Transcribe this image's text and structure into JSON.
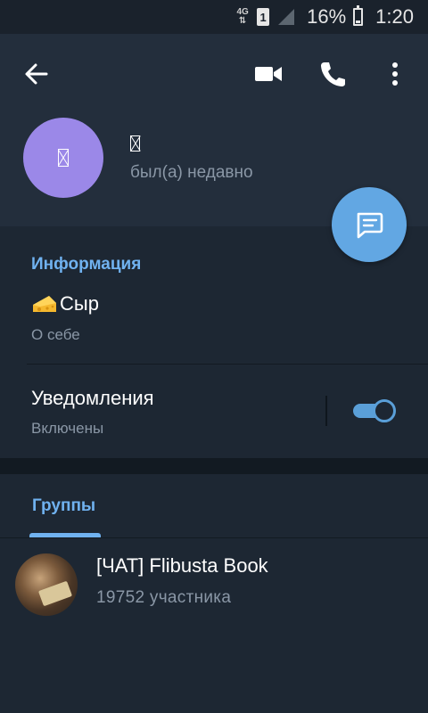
{
  "status_bar": {
    "network": "4G",
    "sim": "1",
    "battery": "16%",
    "battery_level": 0.16,
    "time": "1:20"
  },
  "header": {
    "icons": [
      "back-arrow-icon",
      "video-call-icon",
      "phone-icon",
      "more-vert-icon"
    ],
    "user_status": "был(а) недавно"
  },
  "info": {
    "title": "Информация",
    "bio": "Сыр",
    "bio_caption": "О себе",
    "notifications_label": "Уведомления",
    "notifications_value": "Включены",
    "notifications_enabled": true
  },
  "groups": {
    "tab_label": "Группы",
    "items": [
      {
        "title": "[ЧАТ] Flibusta Book",
        "subtitle": "19752 участника"
      }
    ]
  },
  "colors": {
    "background": "#1d2733",
    "header": "#232e3c",
    "accent": "#70b2f0",
    "fab": "#62a7e3",
    "avatar": "#9b88e8"
  }
}
